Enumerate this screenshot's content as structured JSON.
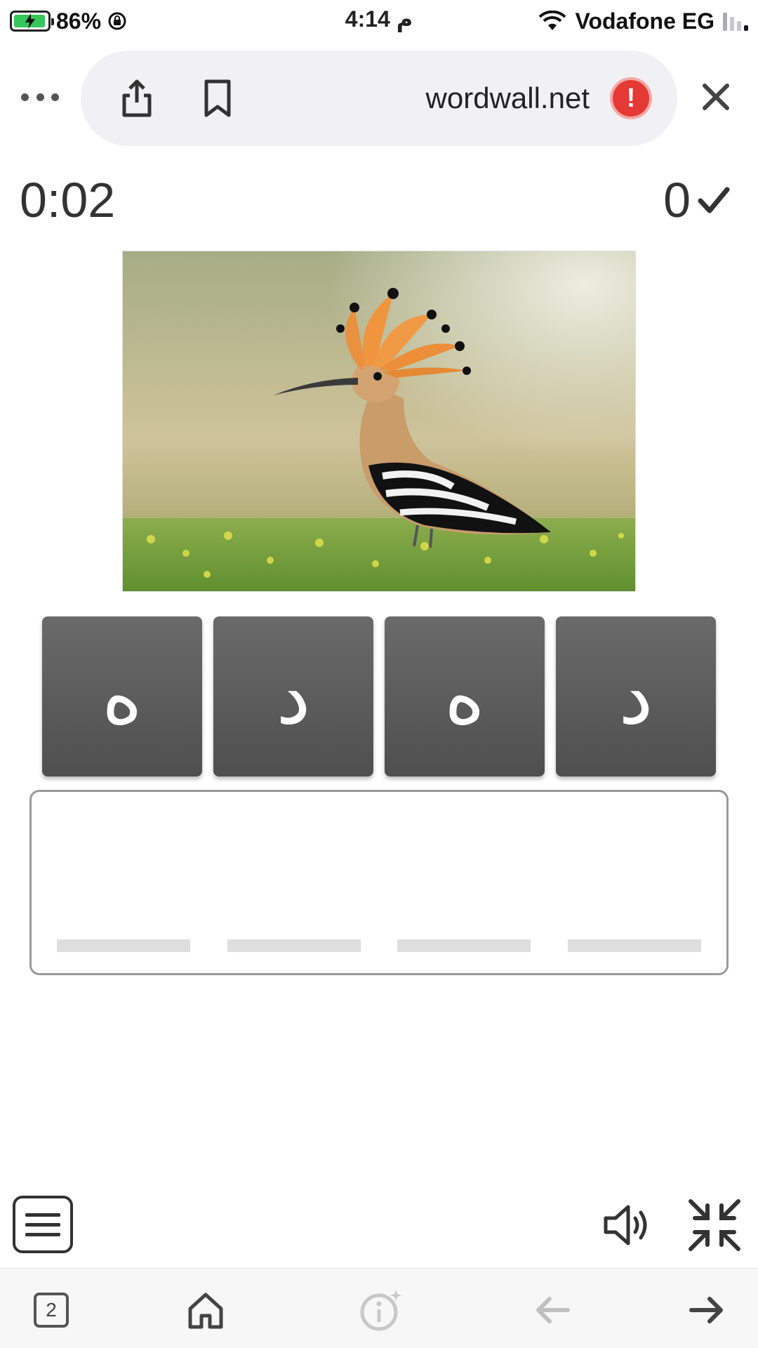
{
  "status_bar": {
    "battery": "86%",
    "time": "4:14 م",
    "carrier": "Vodafone EG"
  },
  "browser": {
    "url": "wordwall.net",
    "alert_symbol": "!",
    "tabs_count": "2"
  },
  "game": {
    "timer": "0:02",
    "score": "0",
    "tiles": [
      "ه",
      "د",
      "ه",
      "د"
    ],
    "answer_slots": 4
  },
  "colors": {
    "tile_bg": "#5c5c5c",
    "alert": "#e53935",
    "battery_fill": "#34c759"
  },
  "icons": {
    "share": "share-icon",
    "bookmark": "bookmark-icon",
    "close": "close-icon",
    "menu": "hamburger-menu-icon",
    "sound": "speaker-icon",
    "collapse": "collapse-icon",
    "home": "home-icon",
    "info": "info-icon",
    "back": "arrow-left-icon",
    "forward": "arrow-right-icon"
  }
}
